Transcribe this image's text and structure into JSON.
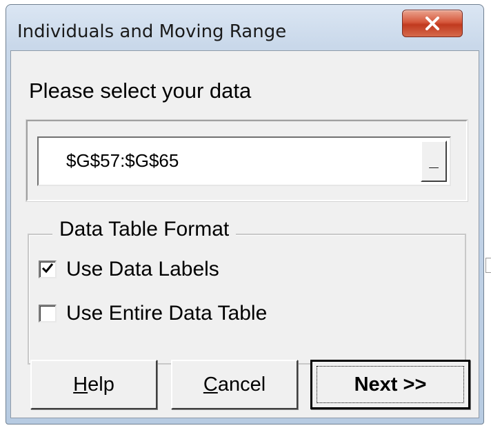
{
  "window": {
    "title": "Individuals and Moving Range",
    "close_icon": "close-icon"
  },
  "dialog": {
    "prompt": "Please select your data",
    "range_input": {
      "value": "$G$57:$G$65",
      "picker_label": "_"
    },
    "format_group": {
      "legend": "Data Table Format",
      "options": [
        {
          "label": "Use Data Labels",
          "checked": true
        },
        {
          "label": "Use Entire Data Table",
          "checked": false
        }
      ]
    },
    "buttons": {
      "help": "Help",
      "cancel": "Cancel",
      "next": "Next >>"
    }
  },
  "colors": {
    "title_bar": "#c9d8ea",
    "close_button": "#c13a1f",
    "dialog_face": "#f0f0f0"
  }
}
